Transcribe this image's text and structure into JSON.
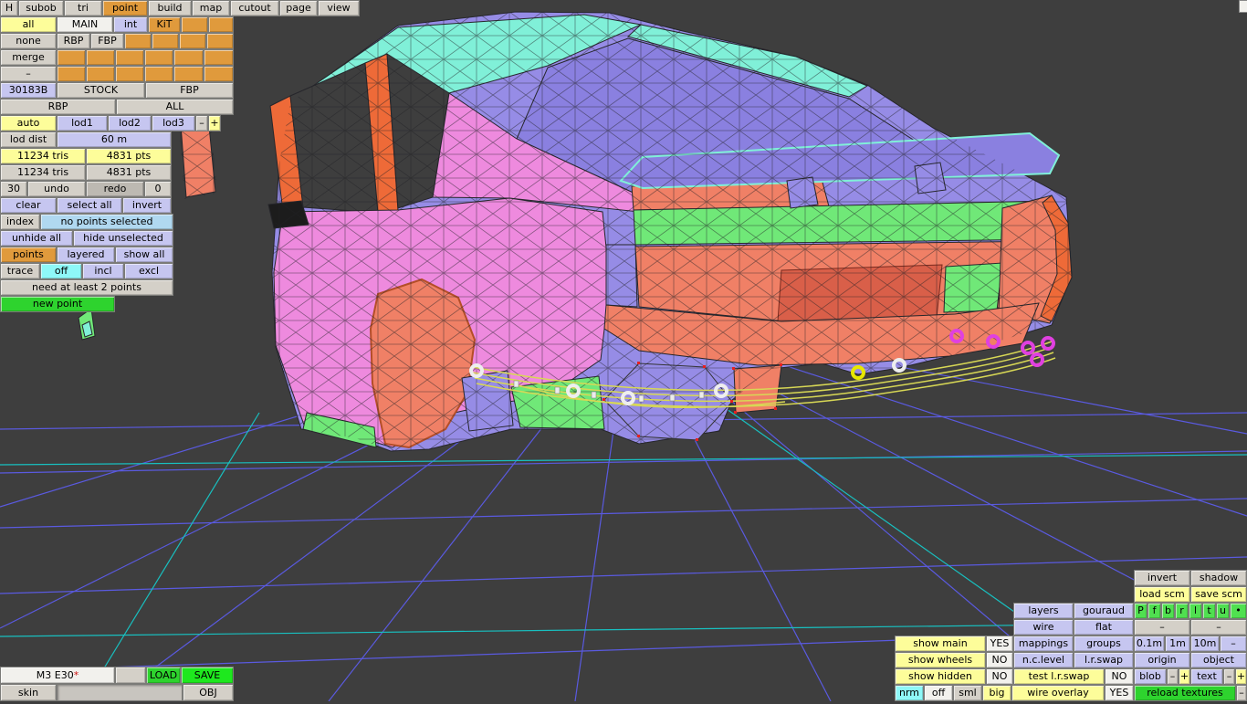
{
  "palette": {
    "panel_gray": "#d4d0c8",
    "button_yellow": "#fdfd9a",
    "button_lavender": "#c6c6f0",
    "button_orange": "#e09a3c",
    "button_green": "#2ed32e",
    "button_green_bright": "#1ee81e",
    "button_cyan": "#8ef8f8",
    "button_white": "#f2f1ed",
    "button_lightblue": "#b0d8f0",
    "flag_green": "#50e050",
    "viewport_gray": "#3e3e3e",
    "grid_blue": "#5a5ae0",
    "grid_cyan": "#18c0c0",
    "car_cyan": "#80f0d8",
    "car_purple": "#968ce6",
    "car_pink": "#ee8ade",
    "car_salmon": "#f08066",
    "car_orange": "#ee6a38",
    "car_green": "#70e878",
    "ring_magenta": "#e040e0",
    "exhaust_yellow": "#d8d855"
  },
  "menu": {
    "h": "H",
    "subob": "subob",
    "tri": "tri",
    "point": "point",
    "build": "build",
    "map": "map",
    "cutout": "cutout",
    "page": "page",
    "view": "view"
  },
  "left": {
    "all": "all",
    "main": "MAIN",
    "int": "int",
    "kit": "KiT",
    "none": "none",
    "rbp": "RBP",
    "fbp": "FBP",
    "merge": "merge",
    "dash": "–",
    "code": "30183B",
    "stock": "STOCK",
    "fbp2": "FBP",
    "rbp2": "RBP",
    "all2": "ALL",
    "auto": "auto",
    "lod1": "lod1",
    "lod2": "lod2",
    "lod3": "lod3",
    "lod_minus": "–",
    "lod_plus": "+",
    "lod_dist": "lod dist",
    "lod_dist_value": "60 m",
    "tris_a": "11234 tris",
    "pts_a": "4831 pts",
    "tris_b": "11234 tris",
    "pts_b": "4831 pts",
    "undo_count": "30",
    "undo": "undo",
    "redo": "redo",
    "redo_count": "0",
    "clear": "clear",
    "select_all": "select all",
    "invert": "invert",
    "index": "index",
    "selection_status": "no points selected",
    "unhide_all": "unhide all",
    "hide_unselected": "hide unselected",
    "points": "points",
    "layered": "layered",
    "show_all": "show all",
    "trace": "trace",
    "off": "off",
    "incl": "incl",
    "excl": "excl",
    "hint": "need at least 2 points",
    "new_point": "new point"
  },
  "file": {
    "name": "M3 E30",
    "dirty": "*",
    "load": "LOAD",
    "save": "SAVE",
    "skin": "skin",
    "obj": "OBJ"
  },
  "render": {
    "invert": "invert",
    "shadow": "shadow",
    "load_scm": "load scm",
    "save_scm": "save scm",
    "layers": "layers",
    "gouraud": "gouraud",
    "flags": [
      "P",
      "f",
      "b",
      "r",
      "l",
      "t",
      "u",
      "•"
    ],
    "wire": "wire",
    "flat": "flat",
    "dash1": "–",
    "dash2": "–",
    "show_main": "show main",
    "show_main_v": "YES",
    "mappings": "mappings",
    "groups": "groups",
    "g01": "0.1m",
    "g1": "1m",
    "g10": "10m",
    "gdash": "–",
    "show_wheels": "show wheels",
    "show_wheels_v": "NO",
    "nclevel": "n.c.level",
    "lrswap": "l.r.swap",
    "origin": "origin",
    "object": "object",
    "show_hidden": "show hidden",
    "show_hidden_v": "NO",
    "test_lrswap": "test l.r.swap",
    "test_lrswap_v": "NO",
    "blob": "blob",
    "blob_minus": "–",
    "blob_plus": "+",
    "text": "text",
    "text_minus": "–",
    "text_plus": "+",
    "nrm": "nrm",
    "off": "off",
    "sml": "sml",
    "big": "big",
    "wire_overlay": "wire overlay",
    "wire_overlay_v": "YES",
    "reload_textures": "reload textures",
    "rt_dash": "–"
  }
}
